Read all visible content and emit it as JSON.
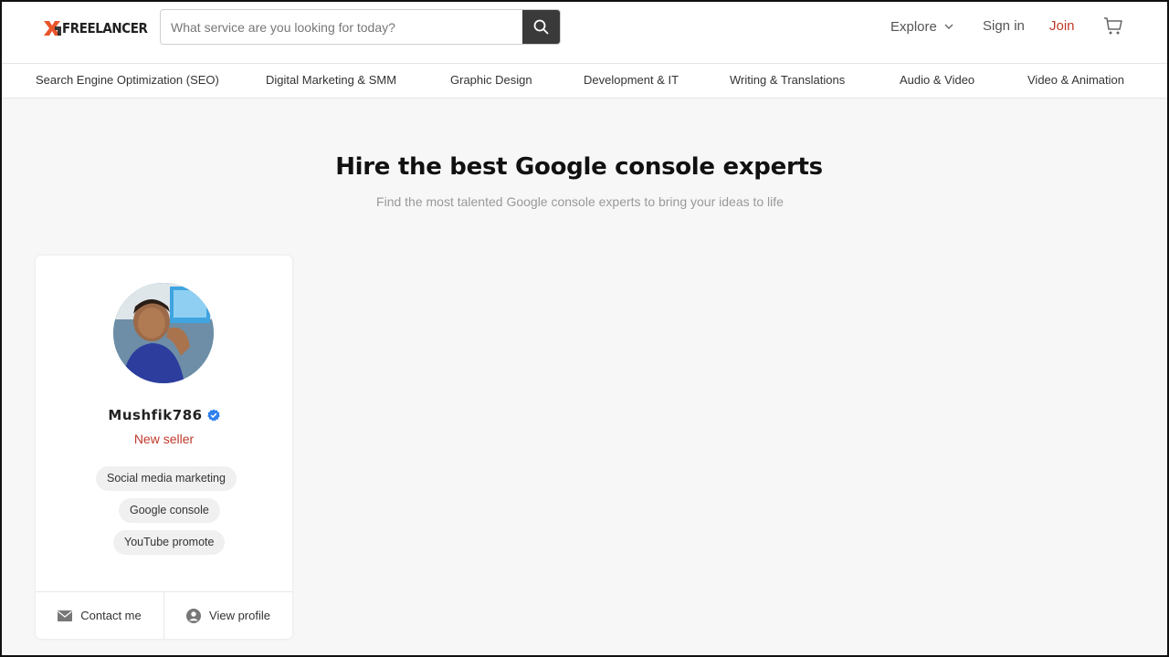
{
  "header": {
    "logo_text": "FREELANCER",
    "search_placeholder": "What service are you looking for today?",
    "explore_label": "Explore",
    "signin_label": "Sign in",
    "join_label": "Join",
    "accent_color": "#c0392b"
  },
  "categories": [
    "Search Engine Optimization (SEO)",
    "Digital Marketing & SMM",
    "Graphic Design",
    "Development & IT",
    "Writing & Translations",
    "Audio & Video",
    "Video & Animation"
  ],
  "hero": {
    "title": "Hire the best Google console experts",
    "subtitle": "Find the most talented Google console experts to bring your ideas to life"
  },
  "seller_card": {
    "name": "Mushfik786",
    "verified_icon": "verified-check-icon",
    "level": "New seller",
    "tags": [
      "Social media marketing",
      "Google console",
      "YouTube promote"
    ],
    "contact_label": "Contact me",
    "profile_label": "View profile"
  }
}
